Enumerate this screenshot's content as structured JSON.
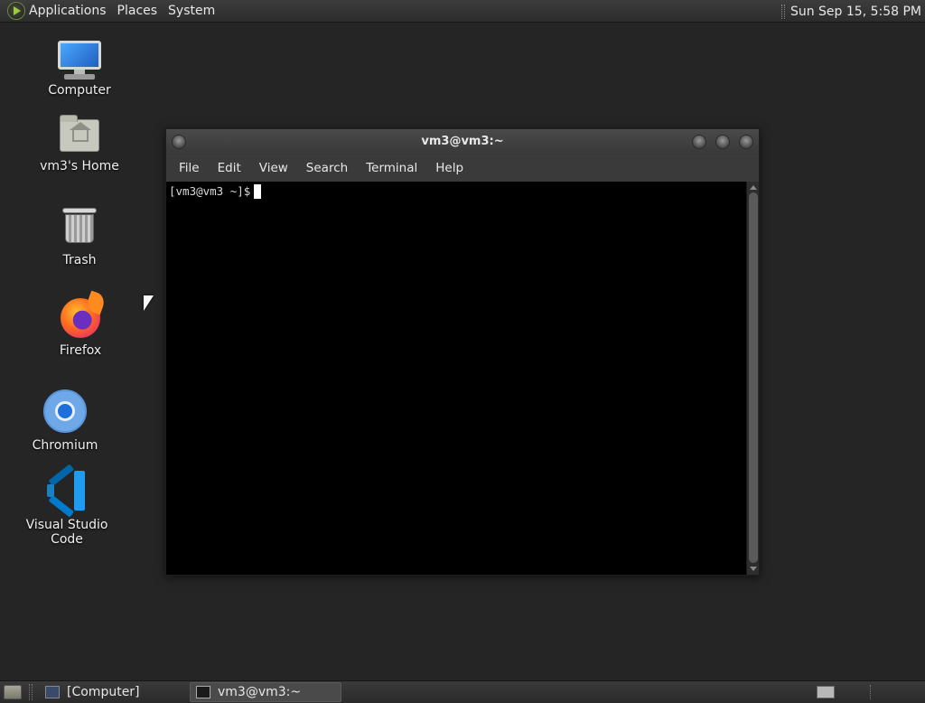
{
  "top_panel": {
    "menus": [
      "Applications",
      "Places",
      "System"
    ],
    "clock": "Sun Sep 15,  5:58 PM"
  },
  "desktop_icons": [
    {
      "label": "Computer",
      "icon": "computer-icon"
    },
    {
      "label": "vm3's Home",
      "icon": "home-folder-icon"
    },
    {
      "label": "Trash",
      "icon": "trash-icon"
    },
    {
      "label": "Firefox",
      "icon": "firefox-icon"
    },
    {
      "label": "Chromium",
      "icon": "chromium-icon"
    },
    {
      "label": "Visual Studio Code",
      "icon": "vscode-icon"
    }
  ],
  "terminal": {
    "title": "vm3@vm3:~",
    "menu": [
      "File",
      "Edit",
      "View",
      "Search",
      "Terminal",
      "Help"
    ],
    "prompt": "[vm3@vm3 ~]$"
  },
  "taskbar": {
    "tasks": [
      {
        "label": "[Computer]",
        "icon": "computer-icon",
        "active": false
      },
      {
        "label": "vm3@vm3:~",
        "icon": "terminal-icon",
        "active": true
      }
    ]
  },
  "colors": {
    "desktop_bg": "#252525",
    "panel_bg": "#333333",
    "terminal_bg": "#000000"
  }
}
